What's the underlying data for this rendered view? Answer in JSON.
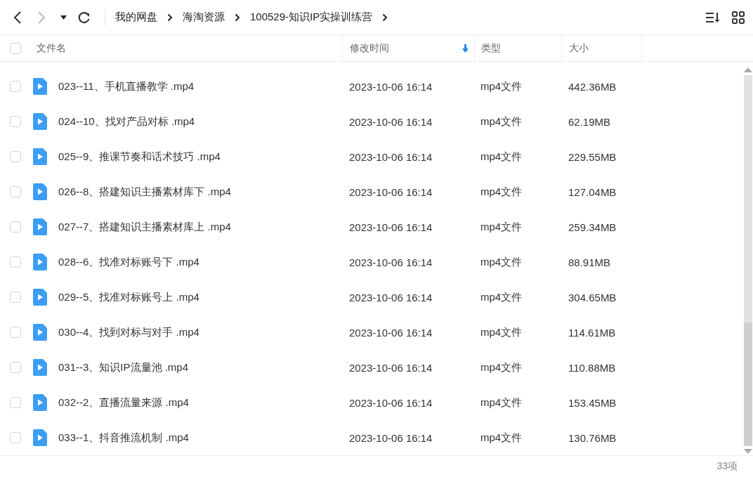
{
  "breadcrumb": [
    "我的网盘",
    "海淘资源",
    "100529-知识IP实操训练营"
  ],
  "table": {
    "columns": [
      {
        "label": "文件名"
      },
      {
        "label": "修改时间",
        "sorted": true
      },
      {
        "label": "类型"
      },
      {
        "label": "大小"
      }
    ],
    "all_checked": false,
    "rows": [
      {
        "name": "023--11、手机直播教学 .mp4",
        "modified": "2023-10-06 16:14",
        "type": "mp4文件",
        "size": "442.36MB",
        "checked": false
      },
      {
        "name": "024--10、找对产品对标 .mp4",
        "modified": "2023-10-06 16:14",
        "type": "mp4文件",
        "size": "62.19MB",
        "checked": false
      },
      {
        "name": "025--9、推课节奏和话术技巧 .mp4",
        "modified": "2023-10-06 16:14",
        "type": "mp4文件",
        "size": "229.55MB",
        "checked": false
      },
      {
        "name": "026--8、搭建知识主播素材库下 .mp4",
        "modified": "2023-10-06 16:14",
        "type": "mp4文件",
        "size": "127.04MB",
        "checked": false
      },
      {
        "name": "027--7、搭建知识主播素材库上 .mp4",
        "modified": "2023-10-06 16:14",
        "type": "mp4文件",
        "size": "259.34MB",
        "checked": false
      },
      {
        "name": "028--6、找准对标账号下 .mp4",
        "modified": "2023-10-06 16:14",
        "type": "mp4文件",
        "size": "88.91MB",
        "checked": false
      },
      {
        "name": "029--5、找准对标账号上 .mp4",
        "modified": "2023-10-06 16:14",
        "type": "mp4文件",
        "size": "304.65MB",
        "checked": false
      },
      {
        "name": "030--4、找到对标与对手 .mp4",
        "modified": "2023-10-06 16:14",
        "type": "mp4文件",
        "size": "114.61MB",
        "checked": false
      },
      {
        "name": "031--3、知识IP流量池 .mp4",
        "modified": "2023-10-06 16:14",
        "type": "mp4文件",
        "size": "110.88MB",
        "checked": false
      },
      {
        "name": "032--2、直播流量来源 .mp4",
        "modified": "2023-10-06 16:14",
        "type": "mp4文件",
        "size": "153.45MB",
        "checked": false
      },
      {
        "name": "033--1、抖音推流机制 .mp4",
        "modified": "2023-10-06 16:14",
        "type": "mp4文件",
        "size": "130.76MB",
        "checked": false
      }
    ]
  },
  "status_bar": {
    "count": "33项"
  }
}
